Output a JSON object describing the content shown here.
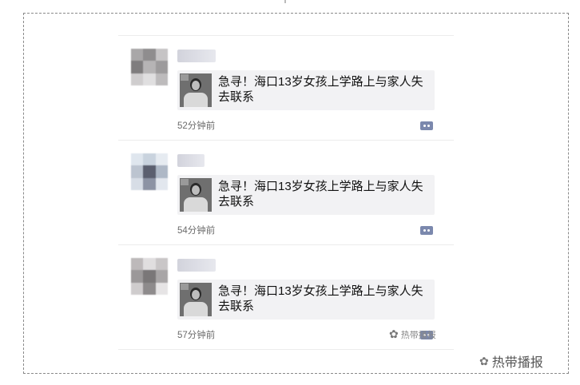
{
  "feed": {
    "items": [
      {
        "title": "急寻！海口13岁女孩上学路上与家人失去联系",
        "time": "52分钟前",
        "avatar_colors": [
          "#a9a7a8",
          "#8f8d8e",
          "#c6c4c5",
          "#7f7d7e",
          "#b6b4b5",
          "#9d9b9c",
          "#cfcdce",
          "#e0dfe0",
          "#bdbbbc"
        ]
      },
      {
        "title": "急寻！海口13岁女孩上学路上与家人失去联系",
        "time": "54分钟前",
        "avatar_colors": [
          "#dfe6ee",
          "#c9d3de",
          "#e6ebf1",
          "#bcc4d0",
          "#5b5f6f",
          "#aeb8c6",
          "#d7dde6",
          "#8c93a4",
          "#e2e7ee"
        ]
      },
      {
        "title": "急寻！海口13岁女孩上学路上与家人失去联系",
        "time": "57分钟前",
        "avatar_colors": [
          "#bdb9ba",
          "#e0dedf",
          "#c9c6c7",
          "#9b9899",
          "#7a7778",
          "#a8a5a6",
          "#cfcccd",
          "#8e8b8c",
          "#e6e4e5"
        ]
      }
    ]
  },
  "watermark": {
    "small": "热带播报",
    "large": "热带播报"
  },
  "icons": {
    "comment": "comment-icon",
    "wechat": "wechat-icon"
  }
}
